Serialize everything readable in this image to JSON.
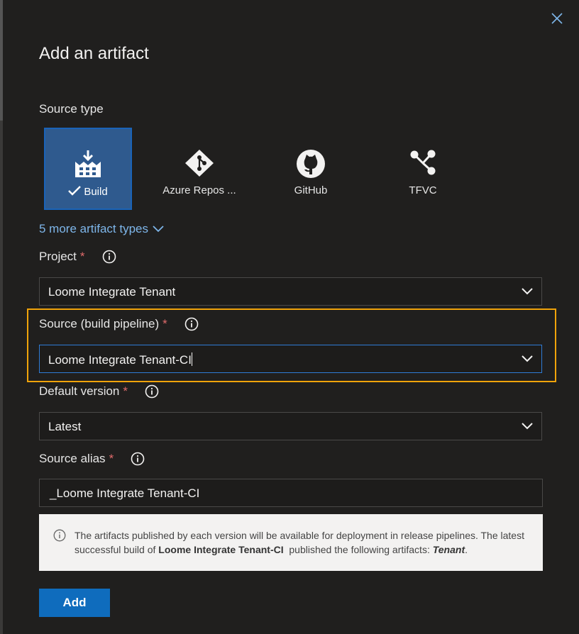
{
  "dialog": {
    "title": "Add an artifact"
  },
  "source_type": {
    "label": "Source type",
    "tiles": [
      {
        "label": "Build",
        "icon": "build-icon",
        "selected": true
      },
      {
        "label": "Azure Repos ...",
        "icon": "azure-repos-icon",
        "selected": false
      },
      {
        "label": "GitHub",
        "icon": "github-icon",
        "selected": false
      },
      {
        "label": "TFVC",
        "icon": "tfvc-icon",
        "selected": false
      }
    ],
    "more_link": "5 more artifact types"
  },
  "fields": {
    "project": {
      "label": "Project",
      "required": "*",
      "value": "Loome Integrate Tenant"
    },
    "source": {
      "label": "Source (build pipeline)",
      "required": "*",
      "value": "Loome Integrate Tenant-CI"
    },
    "default_version": {
      "label": "Default version",
      "required": "*",
      "value": "Latest"
    },
    "source_alias": {
      "label": "Source alias",
      "required": "*",
      "value": "_Loome Integrate Tenant-CI"
    }
  },
  "info_message": {
    "text1": "The artifacts published by each version will be available for deployment in release pipelines. The latest successful build of ",
    "pipeline": "Loome Integrate Tenant-CI",
    "text2": "  published the following artifacts: ",
    "artifact": "Tenant",
    "text3": "."
  },
  "actions": {
    "add_label": "Add"
  },
  "colors": {
    "accent": "#0f6cbd",
    "selected_tile": "#2f5a8e",
    "highlight": "#f0a30a",
    "required": "#e06b6b",
    "link": "#7eb6ea"
  }
}
